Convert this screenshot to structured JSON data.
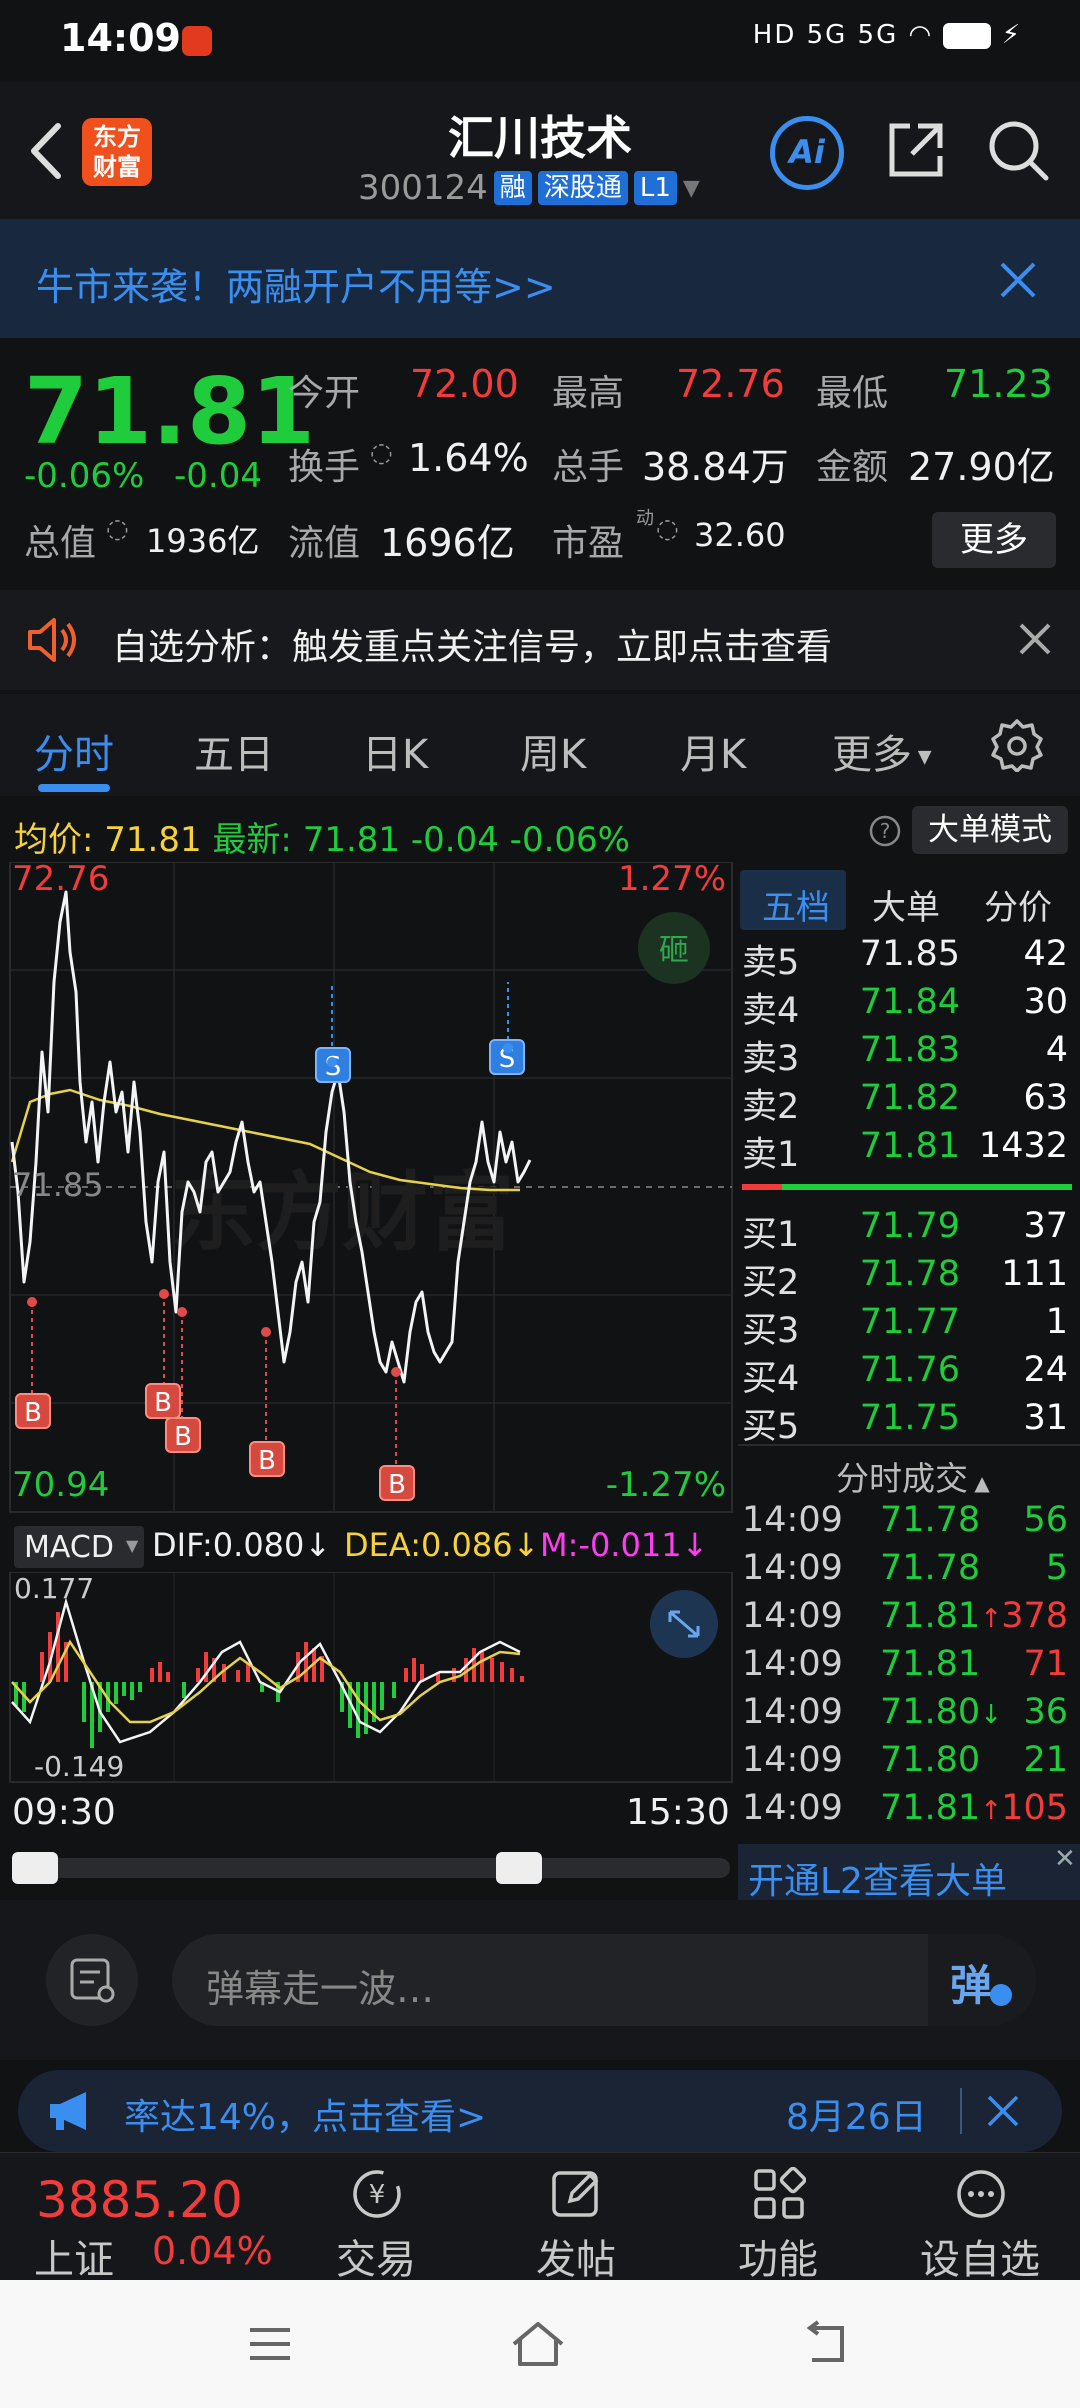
{
  "status_bar": {
    "time": "14:09",
    "signal": "HD 5G 5G"
  },
  "header": {
    "logo_line1": "东方",
    "logo_line2": "财富",
    "title": "汇川技术",
    "code": "300124",
    "tags": [
      "融",
      "深股通",
      "L1"
    ]
  },
  "promo": {
    "text": "牛市来袭！两融开户不用等>>"
  },
  "quote": {
    "price": "71.81",
    "change_pct": "-0.06%",
    "change_val": "-0.04",
    "open_label": "今开",
    "open": "72.00",
    "high_label": "最高",
    "high": "72.76",
    "low_label": "最低",
    "low": "71.23",
    "turnover_label": "换手",
    "turnover": "1.64%",
    "volume_label": "总手",
    "volume": "38.84万",
    "amount_label": "金额",
    "amount": "27.90亿",
    "mktcap_label": "总值",
    "mktcap": "1936亿",
    "float_label": "流值",
    "float": "1696亿",
    "pe_label": "市盈",
    "pe_sup": "动",
    "pe": "32.60",
    "more": "更多"
  },
  "alert": {
    "text": "自选分析：触发重点关注信号，立即点击查看"
  },
  "tabs": [
    "分时",
    "五日",
    "日K",
    "周K",
    "月K",
    "更多"
  ],
  "infoline": {
    "avg_label": "均价:",
    "avg": "71.81",
    "last_label": "最新:",
    "last": "71.81",
    "chg": "-0.04",
    "pct": "-0.06%",
    "big_order": "大单模式"
  },
  "chart_labels": {
    "max": "72.76",
    "min": "70.94",
    "max_pct": "1.27%",
    "min_pct": "-1.27%",
    "ref": "71.85",
    "start_time": "09:30",
    "end_time": "15:30",
    "watermark": "东方财富",
    "badge": "砸"
  },
  "macd": {
    "name": "MACD",
    "dif": "DIF:0.080↓",
    "dea": "DEA:0.086↓",
    "m": "M:-0.011↓",
    "top": "0.177",
    "bottom": "-0.149"
  },
  "book": {
    "tabs": [
      "五档",
      "大单",
      "分价"
    ],
    "asks": [
      {
        "label": "卖5",
        "price": "71.85",
        "vol": "42"
      },
      {
        "label": "卖4",
        "price": "71.84",
        "vol": "30"
      },
      {
        "label": "卖3",
        "price": "71.83",
        "vol": "4"
      },
      {
        "label": "卖2",
        "price": "71.82",
        "vol": "63"
      },
      {
        "label": "卖1",
        "price": "71.81",
        "vol": "1432"
      }
    ],
    "bids": [
      {
        "label": "买1",
        "price": "71.79",
        "vol": "37"
      },
      {
        "label": "买2",
        "price": "71.78",
        "vol": "111"
      },
      {
        "label": "买3",
        "price": "71.77",
        "vol": "1"
      },
      {
        "label": "买4",
        "price": "71.76",
        "vol": "24"
      },
      {
        "label": "买5",
        "price": "71.75",
        "vol": "31"
      }
    ],
    "trades_title": "分时成交",
    "trades": [
      {
        "time": "14:09",
        "price": "71.78",
        "vol": "56",
        "arrow": ""
      },
      {
        "time": "14:09",
        "price": "71.78",
        "vol": "5",
        "arrow": ""
      },
      {
        "time": "14:09",
        "price": "71.81",
        "vol": "378",
        "arrow": "↑"
      },
      {
        "time": "14:09",
        "price": "71.81",
        "vol": "71",
        "arrow": ""
      },
      {
        "time": "14:09",
        "price": "71.80",
        "vol": "36",
        "arrow": "↓"
      },
      {
        "time": "14:09",
        "price": "71.80",
        "vol": "21",
        "arrow": ""
      },
      {
        "time": "14:09",
        "price": "71.81",
        "vol": "105",
        "arrow": "↑"
      }
    ],
    "l2": "开通L2查看大单"
  },
  "comment": {
    "placeholder": "弹幕走一波…",
    "send": "弹"
  },
  "ticker": {
    "text": "率达14%，点击查看>",
    "date": "8月26日"
  },
  "bottom_nav": {
    "index_value": "3885.20",
    "index_name": "上证",
    "index_pct": "0.04%",
    "items": [
      "交易",
      "发帖",
      "功能",
      "设自选"
    ]
  },
  "colors": {
    "up": "#f23b3b",
    "down": "#1fcc3c",
    "accent": "#3a8ef0"
  }
}
